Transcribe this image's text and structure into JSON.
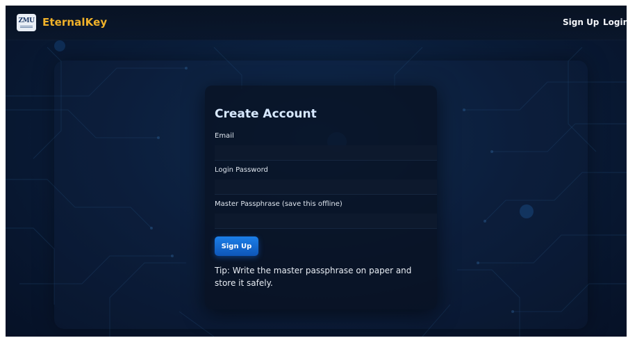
{
  "header": {
    "logo_text": "ZMU",
    "brand": "EternalKey",
    "nav": {
      "signup_label": "Sign Up",
      "login_label": "Login"
    }
  },
  "form": {
    "title": "Create Account",
    "email_label": "Email",
    "email_value": "",
    "password_label": "Login Password",
    "password_value": "",
    "passphrase_label": "Master Passphrase (save this offline)",
    "passphrase_value": "",
    "submit_label": "Sign Up",
    "tip": "Tip: Write the master passphrase on paper and store it safely."
  },
  "colors": {
    "brand": "#f0b22a",
    "accent": "#1c7fe8",
    "title": "#d8e9ff",
    "background": "#0a1d3a"
  }
}
